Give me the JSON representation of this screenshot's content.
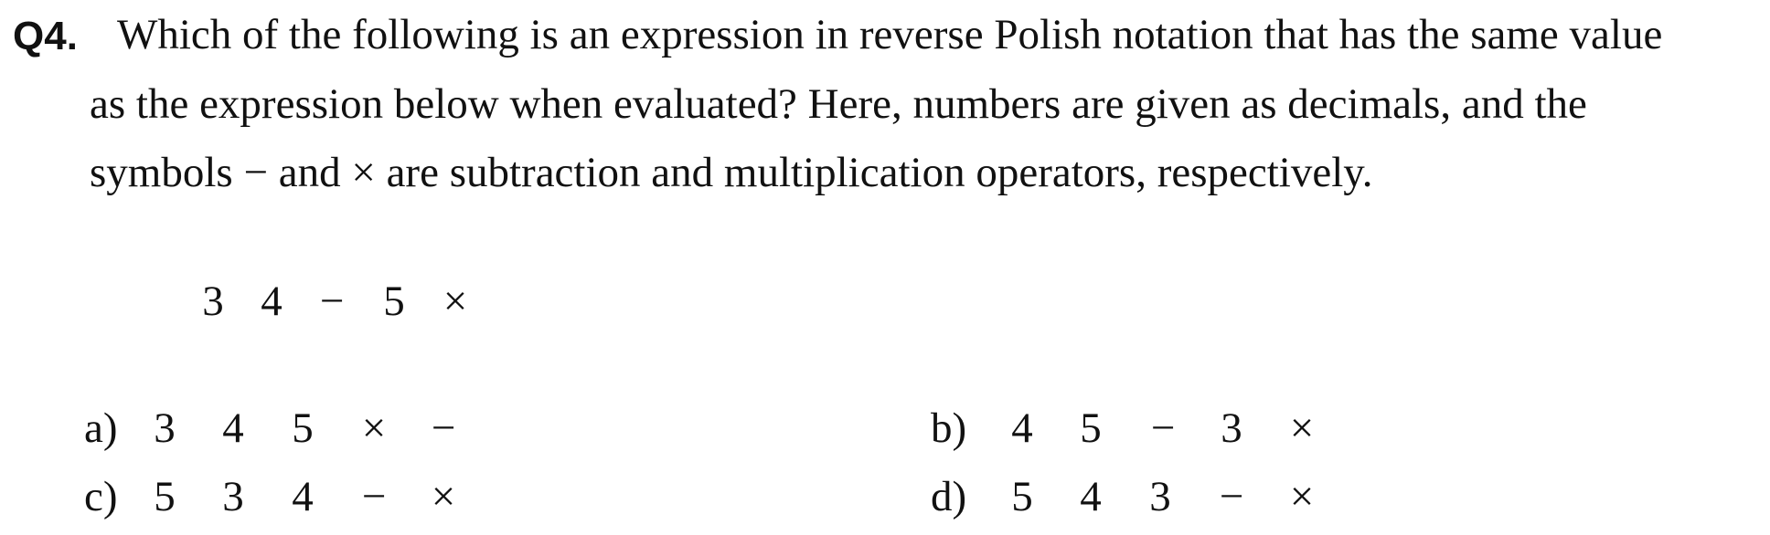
{
  "question": {
    "number": "Q4.",
    "lines": [
      "Which of the following is an expression in reverse Polish notation that has the same value",
      "as the expression below when evaluated? Here, numbers are given as decimals, and the",
      "symbols − and × are subtraction and multiplication operators, respectively."
    ]
  },
  "expression": [
    "3",
    "4",
    "−",
    "5",
    "×"
  ],
  "options": [
    {
      "label": "a)",
      "tokens": [
        "3",
        "4",
        "5",
        "×",
        "−"
      ]
    },
    {
      "label": "b)",
      "tokens": [
        "4",
        "5",
        "−",
        "3",
        "×"
      ]
    },
    {
      "label": "c)",
      "tokens": [
        "5",
        "3",
        "4",
        "−",
        "×"
      ]
    },
    {
      "label": "d)",
      "tokens": [
        "5",
        "4",
        "3",
        "−",
        "×"
      ]
    }
  ]
}
